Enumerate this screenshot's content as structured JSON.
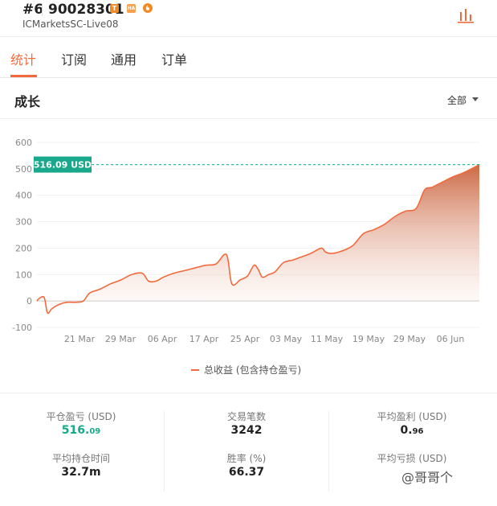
{
  "header": {
    "rank": "#6",
    "account_id": "90028301",
    "server": "ICMarketsSC-Live08",
    "badge_t": "T",
    "badge_ha": "HA"
  },
  "tabs": [
    {
      "label": "统计",
      "active": true
    },
    {
      "label": "订阅",
      "active": false
    },
    {
      "label": "通用",
      "active": false
    },
    {
      "label": "订单",
      "active": false
    }
  ],
  "section": {
    "title": "成长",
    "filter_label": "全部"
  },
  "chart_data": {
    "type": "area",
    "ylim": [
      -100,
      600
    ],
    "yticks": [
      -100,
      0,
      100,
      200,
      300,
      400,
      500,
      600
    ],
    "xticks": [
      "21 Mar",
      "29 Mar",
      "06 Apr",
      "17 Apr",
      "25 Apr",
      "03 May",
      "11 May",
      "19 May",
      "29 May",
      "06 Jun"
    ],
    "current_value_label": "516.09 USD",
    "current_value": 516.09,
    "series": [
      {
        "name": "总收益 (包含持仓盈亏)",
        "color": "#f26a3c",
        "points": [
          [
            0,
            0
          ],
          [
            0.3,
            12
          ],
          [
            0.7,
            12
          ],
          [
            1.0,
            -45
          ],
          [
            1.4,
            -30
          ],
          [
            2.0,
            -15
          ],
          [
            2.8,
            -5
          ],
          [
            3.6,
            -5
          ],
          [
            4.4,
            0
          ],
          [
            5.0,
            30
          ],
          [
            6.0,
            45
          ],
          [
            7.0,
            65
          ],
          [
            8.0,
            80
          ],
          [
            9.0,
            100
          ],
          [
            10.0,
            105
          ],
          [
            10.6,
            75
          ],
          [
            11.3,
            75
          ],
          [
            12.0,
            90
          ],
          [
            13.0,
            105
          ],
          [
            14.0,
            115
          ],
          [
            15.0,
            125
          ],
          [
            16.0,
            135
          ],
          [
            17.0,
            140
          ],
          [
            18.0,
            175
          ],
          [
            18.5,
            65
          ],
          [
            19.3,
            80
          ],
          [
            20.0,
            95
          ],
          [
            20.6,
            135
          ],
          [
            21.0,
            120
          ],
          [
            21.4,
            90
          ],
          [
            22.0,
            100
          ],
          [
            22.6,
            110
          ],
          [
            23.4,
            145
          ],
          [
            24.3,
            155
          ],
          [
            25.0,
            165
          ],
          [
            26.0,
            180
          ],
          [
            27.0,
            200
          ],
          [
            27.4,
            185
          ],
          [
            28.0,
            180
          ],
          [
            29.0,
            190
          ],
          [
            30.0,
            210
          ],
          [
            31.0,
            255
          ],
          [
            32.0,
            270
          ],
          [
            33.0,
            290
          ],
          [
            34.0,
            320
          ],
          [
            35.0,
            340
          ],
          [
            36.0,
            350
          ],
          [
            36.8,
            420
          ],
          [
            37.5,
            430
          ],
          [
            38.5,
            450
          ],
          [
            39.5,
            470
          ],
          [
            40.5,
            485
          ],
          [
            41.5,
            505
          ],
          [
            42.0,
            516.09
          ]
        ]
      }
    ],
    "legend": "总收益 (包含持仓盈亏)",
    "grid": true
  },
  "stats": {
    "closed_pl_label": "平仓盈亏 (USD)",
    "closed_pl_value": "516.",
    "closed_pl_dec": "09",
    "trades_label": "交易笔数",
    "trades_value": "3242",
    "avg_profit_label": "平均盈利 (USD)",
    "avg_profit_value": "0.",
    "avg_profit_dec": "96",
    "avg_hold_label": "平均持仓时间",
    "avg_hold_value": "32.7m",
    "winrate_label": "胜率 (%)",
    "winrate_value": "66.37",
    "avg_loss_label": "平均亏损 (USD)"
  },
  "watermark": "@哥哥个",
  "colors": {
    "accent": "#f26a3c",
    "green": "#19a88c"
  }
}
